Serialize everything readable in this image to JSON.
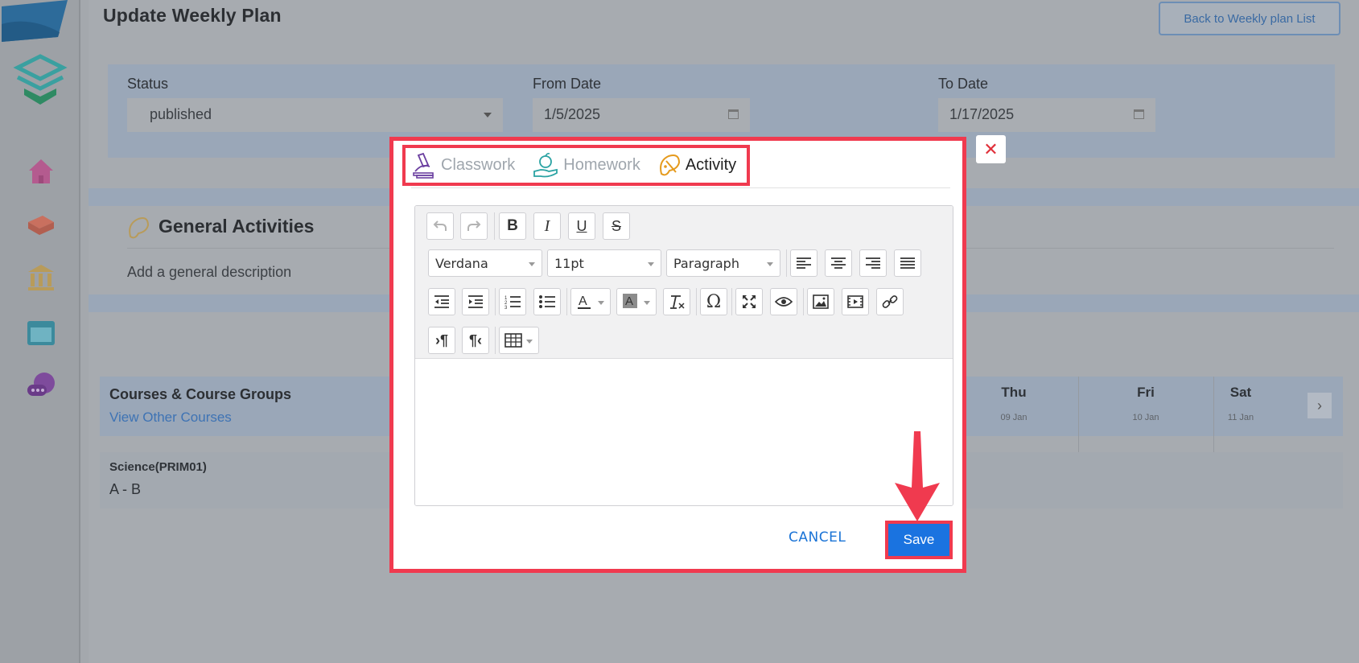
{
  "page": {
    "title": "Update Weekly Plan",
    "back_button": "Back to Weekly plan List"
  },
  "filters": {
    "status_label": "Status",
    "status_value": "published",
    "from_label": "From Date",
    "from_value": "1/5/2025",
    "to_label": "To Date",
    "to_value": "1/17/2025"
  },
  "general_activities": {
    "title": "General Activities",
    "description": "Add a general description"
  },
  "courses": {
    "header": "Courses & Course Groups",
    "link": "View Other Courses",
    "days": [
      {
        "name": "Thu",
        "date": "09 Jan"
      },
      {
        "name": "Fri",
        "date": "10 Jan"
      },
      {
        "name": "Sat",
        "date": "11 Jan"
      }
    ],
    "row": {
      "course": "Science(PRIM01)",
      "section": "A - B"
    }
  },
  "modal": {
    "tabs": [
      {
        "label": "Classwork",
        "icon": "microscope-icon"
      },
      {
        "label": "Homework",
        "icon": "apple-hand-icon"
      },
      {
        "label": "Activity",
        "icon": "palette-icon"
      }
    ],
    "active_tab": "Activity",
    "close_symbol": "✕",
    "editor": {
      "font_family": "Verdana",
      "font_size": "11pt",
      "block_format": "Paragraph"
    },
    "cancel_label": "CANCEL",
    "save_label": "Save"
  },
  "colors": {
    "highlight": "#f03a4f",
    "primary": "#1a73e0",
    "link": "#1a73d6"
  }
}
